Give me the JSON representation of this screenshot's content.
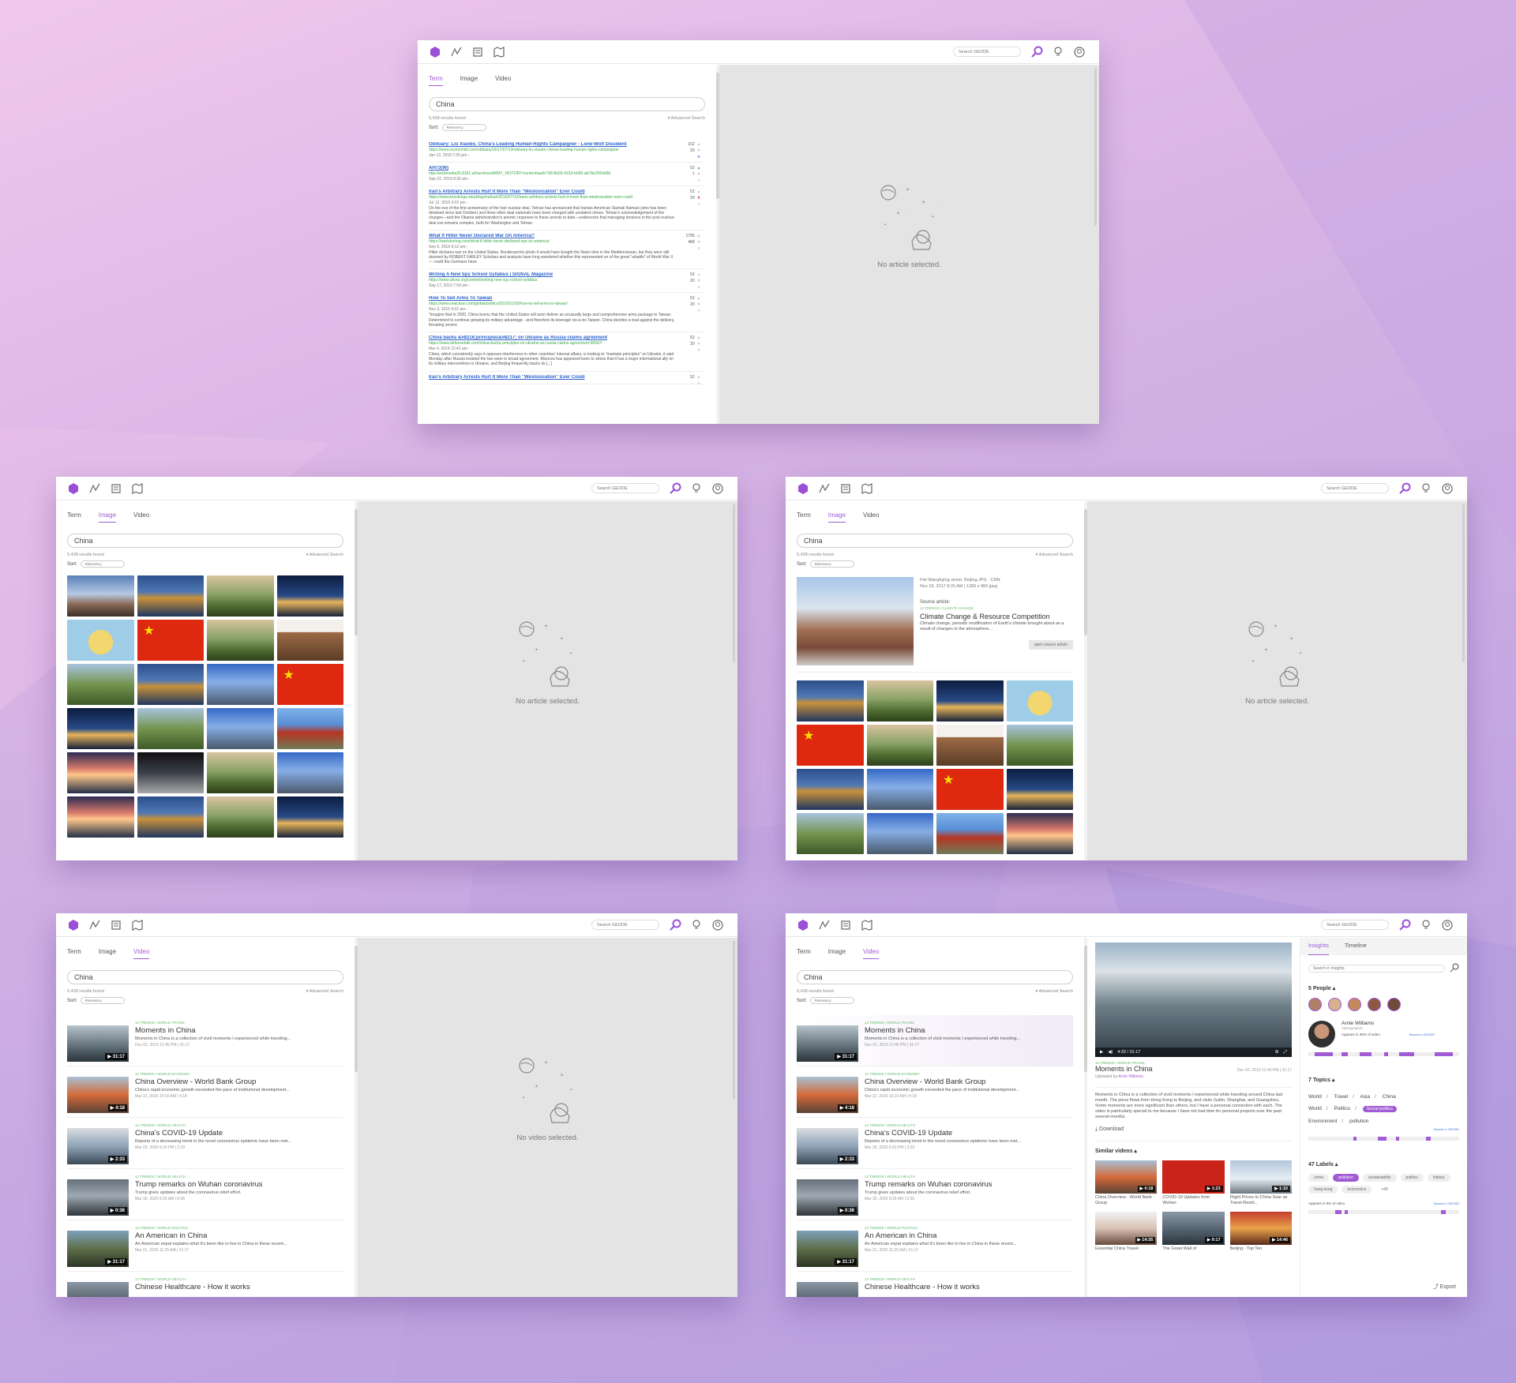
{
  "icons": [
    "geode-logo-icon",
    "pulse-icon",
    "newspaper-icon",
    "map-icon"
  ],
  "global_search_placeholder": "Search GEODE",
  "tabs": [
    "Term",
    "Image",
    "Video"
  ],
  "query": "China",
  "results_count": "5,438 results found",
  "advanced_search": "▾ Advanced Search",
  "sort_label": "Sort:",
  "sort_value": "Relevancy",
  "no_article": "No article selected.",
  "no_video": "No video selected.",
  "term_results": [
    {
      "title": "Obituary: Liu Xiaobo, China's Leading Human-Rights Campaigner - Lone-Wolf Dissident",
      "url": "https://www.economist.com/obituary/2017/07/13/obituary-liu-xiaobo-chinas-leading-human-rights-campaigner",
      "date": "Jan 12, 2018 7:00 pm -",
      "snippet": "",
      "up": "152",
      "down": "20"
    },
    {
      "title": "AH73(W)",
      "url": "http://webmedia26.8181.a6/archive/ARMY_HISTORY/content/aa4c798-8d26-4319-b099-ab78e2554d9b",
      "date": "Sep 22, 2019 9:36 am -",
      "snippet": "",
      "up": "52",
      "down": "7"
    },
    {
      "title": "Iran's Arbitrary Arrests Hurt It More Than \"Westoxication\" Ever Could",
      "url": "https://www.brookings.edu/blog/markaz/2016/07/12/irans-arbitrary-arrests-hurt-it-more-than-westoxication-ever-could",
      "date": "Jul 12, 2016 3:01 pm -",
      "snippet": "On the eve of the first anniversary of the Iran nuclear deal, Tehran has announced that Iranian-American Siamak Namazi (who has been detained since last October) and three other dual nationals have been charged with unstated crimes. Tehran's acknowledgement of the charges—and the Obama administration's anemic response to these arrests to date—underscore that managing tensions in the post nuclear-deal era remains complex, both for Washington and Tehran.",
      "up": "52",
      "down": "20"
    },
    {
      "title": "What If Hitler Never Declared War On America?",
      "url": "https://warisboring.com/what-if-hitler-never-declared-war-on-america/",
      "date": "Sep 9, 2016 9:12 am -",
      "snippet": "Hitler declares war on the United States. Bundesarchiv photo It would have bought the Nazis time in the Mediterranean, but they were still doomed by ROBERT FARLEY Scholars and analysts have long wondered whether this represented on of the great \"whatifs\" of World War II — could the Germans have",
      "up": "1795",
      "down": "468"
    },
    {
      "title": "Writing A New Spy School Syllabus | SIGNAL Magazine",
      "url": "https://www.afcea.org/content/writing-new-spy-school-syllabus",
      "date": "Sep 17, 2019 7:54 am -",
      "snippet": "",
      "up": "52",
      "down": "20"
    },
    {
      "title": "How To Sell Arms To Taiwan",
      "url": "https://www.realclear.com/global/politics/2016/11/03/how-to-sell-arms-to-taiwan/",
      "date": "Nov 3, 2016 9:02 am -",
      "snippet": "\"Imagine that in 2020, China learns that the United States will soon deliver an unusually large and comprehensive arms package to Taiwan. Determined to continue growing its military advantage - and therefore its leverage vis-à-vis Taiwan. China decides a rival against the delivery, threating severe",
      "up": "52",
      "down": "20"
    },
    {
      "title": "China backs &#8216;principles&#8217; on Ukraine as Russia claims agreement",
      "url": "https://www.defensetalk.com/china-backs-principles-on-ukraine-as-russia-claims-agreement-58997/",
      "date": "Mar 4, 2014 12:41 am -",
      "snippet": "China, which consistently says it opposes interference in other countries' internal affairs, is looking to \"maintain principles\" on Ukraine, it said Monday after Russia insisted the two were in broad agreement. Moscow has appeared keen to stress that it has a major international ally on its military interventions in Ukraine, and Beijing frequently backs its [...]",
      "up": "52",
      "down": "20"
    },
    {
      "title": "Iran's Arbitrary Arrests Hurt It More Than \"Westoxication\" Ever Could",
      "url": "",
      "date": "",
      "snippet": "",
      "up": "52",
      "down": ""
    }
  ],
  "image_detail": {
    "file": "File:Wangfujing street, Beijing.JPG · CNN",
    "meta": "Nov 29, 2017 8:25 AM | 1280 x 960 jpeg",
    "source_label": "Source article:",
    "crumb": "12 TRENDS / CLIMATE CHANGE",
    "title": "Climate Change & Resource Competition",
    "desc": "Climate change, periodic modification of Earth's climate brought about as a result of changes in the atmosphere...",
    "button": "open source article"
  },
  "videos": [
    {
      "crumb": "12 TRENDS / WORLD TRAVEL",
      "title": "Moments in China",
      "desc": "Moments in China is a collection of vivid moments I experienced while traveling...",
      "date": "Dec 02, 2019 12:45 PM | 31:17",
      "dur": "▶ 31:17"
    },
    {
      "crumb": "12 TRENDS / WORLD ECONOMY",
      "title": "China Overview - World Bank Group",
      "desc": "China's rapid economic growth exceeded the pace of institutional development...",
      "date": "Mar 22, 2020 10:10 AM | 4:18",
      "dur": "▶ 4:18"
    },
    {
      "crumb": "12 TRENDS / WORLD HEALTH",
      "title": "China's COVID-19 Update",
      "desc": "Reports of a decreasing trend in the novel coronavirus epidemic have been met...",
      "date": "Mar 29, 2020 6:20 PM | 2:33",
      "dur": "▶ 2:33"
    },
    {
      "crumb": "12 TRENDS / WORLD HEALTH",
      "title": "Trump remarks on Wuhan coronavirus",
      "desc": "Trump gives updates about the coronavirus relief effort.",
      "date": "Mar 30, 2020 8:25 AM | 0:36",
      "dur": "▶ 0:36"
    },
    {
      "crumb": "12 TRENDS / WORLD POLITICS",
      "title": "An American in China",
      "desc": "An American expat explains what it's been like to live in China in these recent...",
      "date": "Mar 21, 2020 11:25 AM | 31:17",
      "dur": "▶ 31:17"
    },
    {
      "crumb": "12 TRENDS / WORLD HEALTH",
      "title": "Chinese Healthcare - How it works",
      "desc": "",
      "date": "",
      "dur": ""
    }
  ],
  "video_detail": {
    "time": "4:32 / 31:17",
    "crumb": "12 TRENDS / WORLD TRAVEL",
    "title": "Moments in China",
    "date": "Dec 02, 2019 12:45 PM | 31:17",
    "uploaded_prefix": "Uploaded by ",
    "uploader": "Arnie Williams",
    "desc": "Moments in China is a collection of vivid moments I experienced while traveling around China last month. The piece flows from Hong Kong to Beijing, and visits Guilin, Shanghai, and Guangzhou. Some moments are more significant than others, but I have a personal connection with each. The video is particularly special to me because I have not had time for personal projects over the past several months.",
    "download": "Download",
    "similar": "Similar videos ▴",
    "similar_items": [
      {
        "label": "China Overview - World Bank Group",
        "dur": "▶ 4:18"
      },
      {
        "label": "COVID-19 Updates from Wuhan",
        "dur": "▶ 1:23"
      },
      {
        "label": "Flight Prices to China Soar as Travel Restri...",
        "dur": "▶ 1:10"
      },
      {
        "label": "Essential China Travel",
        "dur": "▶ 14:35"
      },
      {
        "label": "The Great Wall of",
        "dur": "▶ 9:17"
      },
      {
        "label": "Beijing - Top Ten",
        "dur": "▶ 14:46"
      }
    ]
  },
  "insights": {
    "tabs": [
      "Insights",
      "Timeline"
    ],
    "search_placeholder": "Search in Insights",
    "people_heading": "5 People ▴",
    "person_name": "Arnie Williams",
    "person_role": "Videographer",
    "appears": "Appears in 35% of video",
    "search_link": "Search in GEODE",
    "topics_heading": "7 Topics ▴",
    "topics": [
      "World",
      "Travel",
      "Asia",
      "China",
      "World",
      "Politics",
      "Social politics",
      "Environment",
      "pollution"
    ],
    "labels_heading": "47 Labels ▴",
    "labels": [
      "crime",
      "pollution",
      "sustainability",
      "politics",
      "history",
      "hong kong",
      "economics",
      "+40"
    ],
    "labels_appears": "Appears in 9% of video",
    "export": "Export"
  }
}
